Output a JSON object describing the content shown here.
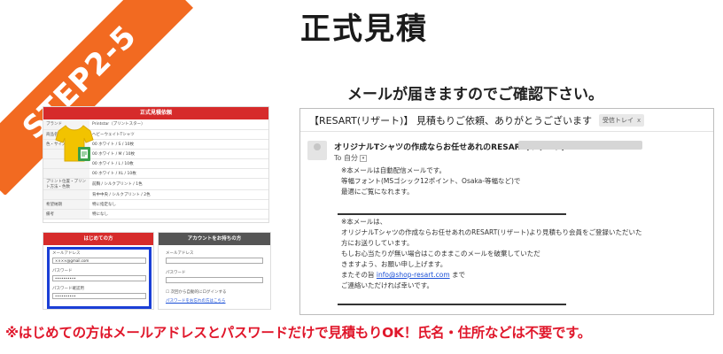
{
  "ribbon": {
    "label": "STEP2-5",
    "color": "#f26a21"
  },
  "title": "正式見積",
  "mail_notice": "メールが届きますのでご確認下さい。",
  "estimate_form": {
    "header": "正式見積依頼",
    "rows": [
      {
        "label": "ブランド",
        "value": "Printstar（プリントスター）"
      },
      {
        "label": "商品名",
        "value": "ヘビーウェイトTシャツ"
      },
      {
        "label": "色・サイズ・枚数",
        "value": "00 ホワイト / S / 10枚"
      },
      {
        "label": "",
        "value": "00 ホワイト / M / 10枚"
      },
      {
        "label": "",
        "value": "00 ホワイト / L / 10枚"
      },
      {
        "label": "",
        "value": "00 ホワイト / XL / 10枚"
      },
      {
        "label": "プリント位置・プリント方法・色数",
        "value": "前胸 / シルクプリント / 1色"
      },
      {
        "label": "",
        "value": "背中中央 / シルクプリント / 2色"
      },
      {
        "label": "希望納期",
        "value": "特に指定なし"
      },
      {
        "label": "備考",
        "value": "特になし"
      }
    ]
  },
  "new_user_panel": {
    "header": "はじめての方",
    "email_label": "メールアドレス",
    "email_value": "××××@gmail.com",
    "password_label": "パスワード",
    "password_value": "••••••••••",
    "confirm_label": "パスワード確認用",
    "confirm_value": "••••••••••",
    "highlight_color": "#1b3fd6"
  },
  "account_panel": {
    "header": "アカウントをお持ちの方",
    "email_label": "メールアドレス",
    "password_label": "パスワード",
    "remember_label": "次回から自動的にログインする",
    "forgot_link": "パスワードをお忘れの方はこちら"
  },
  "mail": {
    "subject": "【RESART(リザート)】 見積もりご依頼、ありがとうございます",
    "inbox_tag": "受信トレイ",
    "inbox_close": "x",
    "sender": "オリジナルTシャツの作成ならお任せあれのRESART(リザート)",
    "to": "To 自分",
    "to_dropdown": "▾",
    "body_top": [
      "※本メールは自動配信メールです。",
      "等幅フォント(MSゴシック12ポイント、Osaka-等幅など)で",
      "最適にご覧になれます。"
    ],
    "body_main": [
      "※本メールは、",
      "オリジナルTシャツの作成ならお任せあれのRESART(リザート)より見積もり会員をご登録いただいた",
      "方にお送りしています。",
      "もしお心当たりが無い場合はこのままこのメールを破棄していただ",
      "きますよう、お願い申し上げます。",
      "またその旨",
      "ご連絡いただければ幸いです。"
    ],
    "contact_email": "info@shop-resart.com",
    "contact_suffix": " まで"
  },
  "footer_note": "※はじめての方はメールアドレスとパスワードだけで見積もりOK！氏名・住所などは不要です。"
}
